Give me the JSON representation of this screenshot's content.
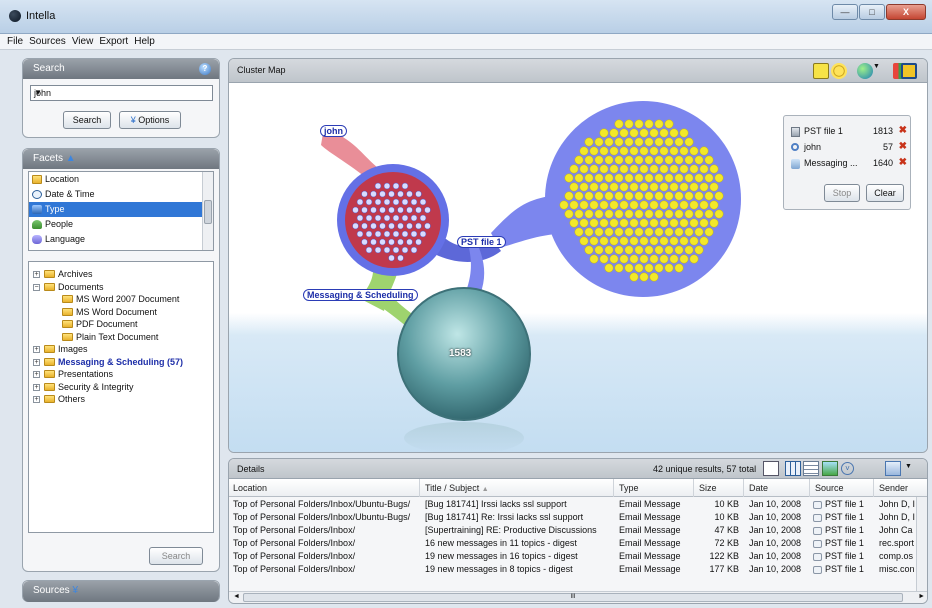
{
  "window": {
    "title": "Intella",
    "minimize": "—",
    "maximize": "□",
    "close": "X"
  },
  "menu": [
    "File",
    "Sources",
    "View",
    "Export",
    "Help"
  ],
  "search": {
    "header": "Search",
    "help_icon": "?",
    "query": "john",
    "search_button": "Search",
    "options_button": "Options"
  },
  "facets": {
    "header": "Facets",
    "items": [
      {
        "label": "Location",
        "icon": "folder-icon"
      },
      {
        "label": "Date & Time",
        "icon": "clock-icon"
      },
      {
        "label": "Type",
        "icon": "type-icon",
        "selected": true
      },
      {
        "label": "People",
        "icon": "people-icon"
      },
      {
        "label": "Language",
        "icon": "language-icon"
      }
    ],
    "tree": [
      {
        "label": "Archives",
        "level": 0,
        "expander": "+"
      },
      {
        "label": "Documents",
        "level": 0,
        "expander": "−"
      },
      {
        "label": "MS Word 2007 Document",
        "level": 1
      },
      {
        "label": "MS Word Document",
        "level": 1
      },
      {
        "label": "PDF Document",
        "level": 1
      },
      {
        "label": "Plain Text Document",
        "level": 1
      },
      {
        "label": "Images",
        "level": 0,
        "expander": "+"
      },
      {
        "label": "Messaging & Scheduling  (57)",
        "level": 0,
        "expander": "+",
        "bold": true
      },
      {
        "label": "Presentations",
        "level": 0,
        "expander": "+"
      },
      {
        "label": "Security & Integrity",
        "level": 0,
        "expander": "+"
      },
      {
        "label": "Others",
        "level": 0,
        "expander": "+"
      }
    ],
    "search_button": "Search"
  },
  "sources": {
    "header": "Sources"
  },
  "cluster_map": {
    "header": "Cluster Map",
    "labels": {
      "john": "john",
      "pst": "PST file 1",
      "messaging": "Messaging & Scheduling",
      "big_count": "1583"
    },
    "legend": [
      {
        "name": "PST file 1",
        "count": "1813",
        "icon": "pst-icon"
      },
      {
        "name": "john",
        "count": "57",
        "icon": "search-query-icon"
      },
      {
        "name": "Messaging ...",
        "count": "1640",
        "icon": "messaging-icon"
      }
    ],
    "stop_button": "Stop",
    "clear_button": "Clear",
    "colors": {
      "red": "#c0394c",
      "blue": "#7c86ee",
      "yellow": "#f2e82a",
      "teal": "#3f7f86",
      "green": "#9ed36e"
    }
  },
  "details": {
    "header": "Details",
    "summary": "42 unique results, 57 total",
    "columns": [
      "Location",
      "Title / Subject",
      "Type",
      "Size",
      "Date",
      "Source",
      "Sender"
    ],
    "sort_indicator": "▲",
    "rows": [
      [
        "Top of Personal Folders/Inbox/Ubuntu-Bugs/",
        "[Bug 181741] Irssi lacks ssl support",
        "Email Message",
        "10 KB",
        "Jan 10, 2008",
        "PST file 1",
        "John D, I"
      ],
      [
        "Top of Personal Folders/Inbox/Ubuntu-Bugs/",
        "[Bug 181741] Re: Irssi lacks ssl support",
        "Email Message",
        "10 KB",
        "Jan 10, 2008",
        "PST file 1",
        "John D, I"
      ],
      [
        "Top of Personal Folders/Inbox/",
        "[Supertraining] RE: Productive Discussions",
        "Email Message",
        "47 KB",
        "Jan 10, 2008",
        "PST file 1",
        "John Ca"
      ],
      [
        "Top of Personal Folders/Inbox/",
        "16 new messages in 11 topics - digest",
        "Email Message",
        "72 KB",
        "Jan 10, 2008",
        "PST file 1",
        "rec.sport"
      ],
      [
        "Top of Personal Folders/Inbox/",
        "19 new messages in 16 topics - digest",
        "Email Message",
        "122 KB",
        "Jan 10, 2008",
        "PST file 1",
        "comp.os"
      ],
      [
        "Top of Personal Folders/Inbox/",
        "19 new messages in 8 topics - digest",
        "Email Message",
        "177 KB",
        "Jan 10, 2008",
        "PST file 1",
        "misc.con"
      ]
    ],
    "hscroll_mark": "III"
  }
}
